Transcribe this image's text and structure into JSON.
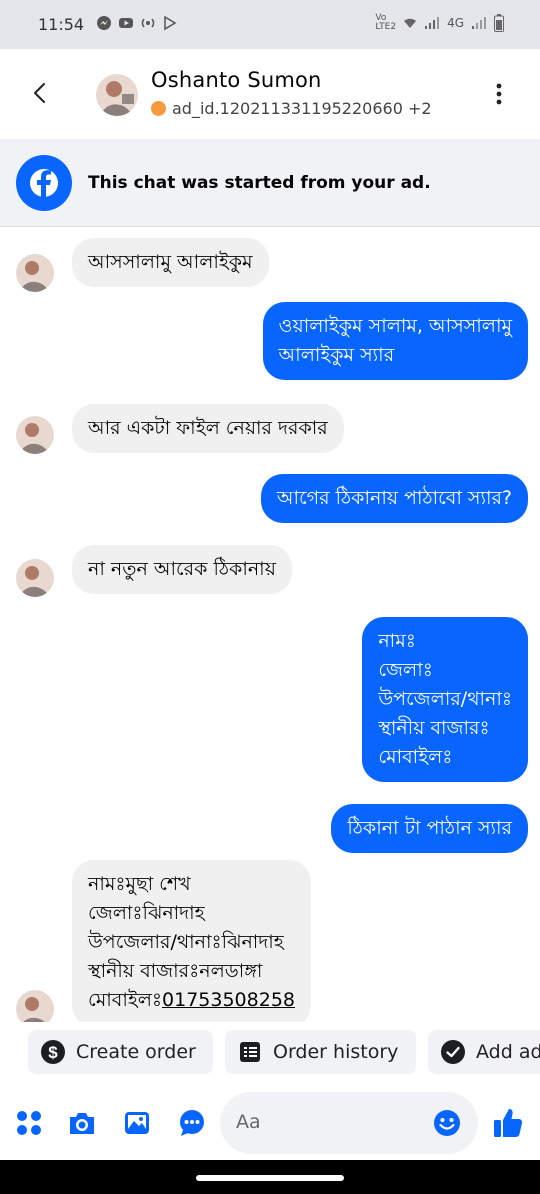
{
  "status_bar": {
    "time": "11:54",
    "network": "4G"
  },
  "header": {
    "name": "Oshanto Sumon",
    "subtitle": "ad_id.120211331195220660 +2",
    "status_color": "#f59b3d"
  },
  "banner": {
    "text": "This chat was started from your ad."
  },
  "messages": [
    {
      "side": "in",
      "text": "আসসালামু আলাইকুম"
    },
    {
      "side": "out",
      "text": "ওয়ালাইকুম সালাম, আসসালামু\nআলাইকুম স্যার"
    },
    {
      "side": "in",
      "text": "আর একটা ফাইল নেয়ার দরকার"
    },
    {
      "side": "out",
      "text": "আগের ঠিকানায় পাঠাবো স্যার?"
    },
    {
      "side": "in",
      "text": "না নতুন আরেক ঠিকানায়"
    },
    {
      "side": "out",
      "text": "নামঃ\nজেলাঃ\nউপজেলার/থানাঃ\nস্থানীয় বাজারঃ\nমোবাইলঃ"
    },
    {
      "side": "out",
      "text": "ঠিকানা টা পাঠান স্যার"
    },
    {
      "side": "in",
      "text": "নামঃমুছা শেখ\nজেলাঃঝিনাদাহ\nউপজেলার/থানাঃঝিনাদাহ\nস্থানীয় বাজারঃনলডাঙ্গা\nমোবাইলঃ",
      "phone": "01753508258"
    }
  ],
  "quick_actions": [
    {
      "label": "Create order",
      "icon": "dollar-circle-icon"
    },
    {
      "label": "Order history",
      "icon": "receipt-icon"
    },
    {
      "label": "Add ad",
      "icon": "check-circle-icon"
    }
  ],
  "composer": {
    "placeholder": "Aa"
  },
  "colors": {
    "accent": "#0866ff",
    "incoming_bubble": "#f0f0f0"
  }
}
